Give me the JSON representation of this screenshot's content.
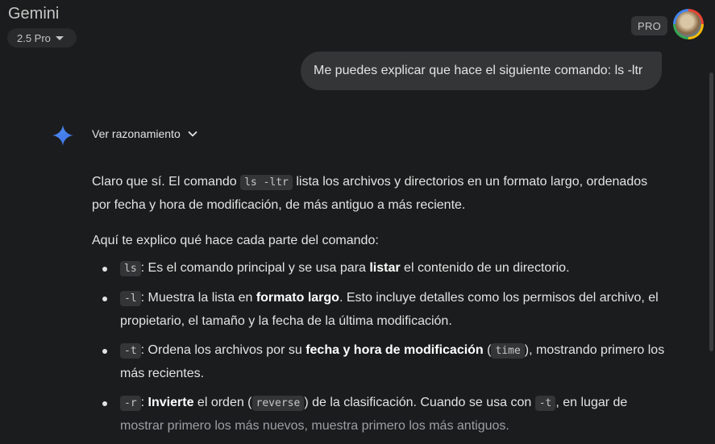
{
  "header": {
    "app_title": "Gemini",
    "model_label": "2.5 Pro",
    "pro_badge": "PRO"
  },
  "user_message": "Me puedes explicar que hace el siguiente comando: ls -ltr",
  "reasoning_label": "Ver razonamiento",
  "response": {
    "p1_a": "Claro que sí. El comando ",
    "p1_code": "ls -ltr",
    "p1_b": " lista los archivos y directorios en un formato largo, ordenados por fecha y hora de modificación, de más antiguo a más reciente.",
    "p2": "Aquí te explico qué hace cada parte del comando:",
    "items": [
      {
        "code": "ls",
        "a": ": Es el comando principal y se usa para ",
        "bold": "listar",
        "b": " el contenido de un directorio."
      },
      {
        "code": "-l",
        "a": ": Muestra la lista en ",
        "bold": "formato largo",
        "b": ". Esto incluye detalles como los permisos del archivo, el propietario, el tamaño y la fecha de la última modificación."
      },
      {
        "code": "-t",
        "a": ": Ordena los archivos por su ",
        "bold": "fecha y hora de modificación",
        "b": " (",
        "code2": "time",
        "c": "), mostrando primero los más recientes."
      },
      {
        "code": "-r",
        "a": ": ",
        "bold": "Invierte",
        "b": " el orden (",
        "code2": "reverse",
        "c": ") de la clasificación. Cuando se usa con ",
        "code3": "-t",
        "d": ", en lugar de ",
        "e": "mostrar primero los más nuevos, muestra primero los más antiguos."
      }
    ]
  },
  "colors": {
    "background": "#1b1c1d",
    "bubble": "#333537",
    "gem_blue": "#4285f4"
  }
}
